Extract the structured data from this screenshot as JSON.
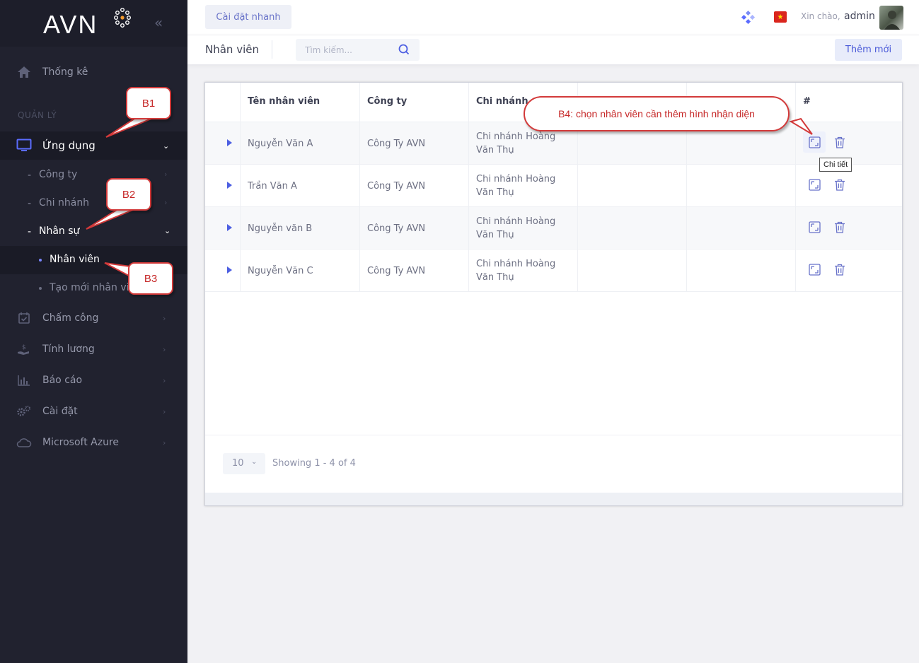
{
  "brand": {
    "name": "AVN"
  },
  "sidebar": {
    "dashboard": "Thống kê",
    "section_label": "QUẢN LÝ",
    "apps": "Ứng dụng",
    "sub": {
      "company": "Công ty",
      "branch": "Chi nhánh",
      "hr": "Nhân sự",
      "employee": "Nhân viên",
      "new_employee": "Tạo mới nhân viên"
    },
    "items": {
      "attendance": "Chấm công",
      "payroll": "Tính lương",
      "report": "Báo cáo",
      "settings": "Cài đặt",
      "azure": "Microsoft Azure"
    }
  },
  "header": {
    "quick_settings": "Cài đặt nhanh",
    "greeting": "Xin chào,",
    "user": "admin",
    "flag": "vietnam-flag"
  },
  "subbar": {
    "title": "Nhân viên",
    "search_placeholder": "Tìm kiếm...",
    "add_button": "Thêm mới"
  },
  "table": {
    "headers": [
      "Tên nhân viên",
      "Công ty",
      "Chi nhánh",
      "",
      "",
      "#"
    ],
    "rows": [
      {
        "name": "Nguyễn Văn A",
        "company": "Công Ty AVN",
        "branch": "Chi nhánh Hoàng Văn Thụ"
      },
      {
        "name": "Trần Văn A",
        "company": "Công Ty AVN",
        "branch": "Chi nhánh Hoàng Văn Thụ"
      },
      {
        "name": "Nguyễn văn B",
        "company": "Công Ty AVN",
        "branch": "Chi nhánh Hoàng Văn Thụ"
      },
      {
        "name": "Nguyễn Văn C",
        "company": "Công Ty AVN",
        "branch": "Chi nhánh Hoàng Văn Thụ"
      }
    ],
    "tooltip": "Chi tiết",
    "page_size": "10",
    "showing": "Showing 1 - 4 of 4"
  },
  "annotations": {
    "b1": "B1",
    "b2": "B2",
    "b3": "B3",
    "b4": "B4: chọn nhân viên cần thêm hình nhận diện"
  },
  "colors": {
    "sidebar_bg": "#21222f",
    "accent": "#4d5fe2",
    "annotation_red": "#d33a3a"
  }
}
